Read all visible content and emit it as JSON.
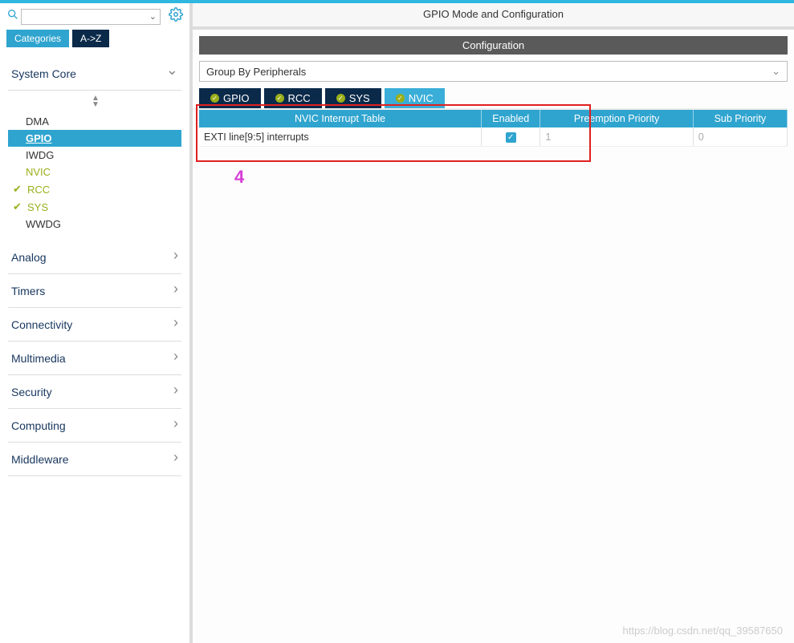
{
  "sidebar": {
    "tabs": {
      "categories": "Categories",
      "az": "A->Z"
    },
    "groups": [
      {
        "name": "System Core",
        "expanded": true,
        "items": [
          {
            "label": "DMA",
            "state": "plain"
          },
          {
            "label": "GPIO",
            "state": "selected"
          },
          {
            "label": "IWDG",
            "state": "plain"
          },
          {
            "label": "NVIC",
            "state": "nvic"
          },
          {
            "label": "RCC",
            "state": "checked"
          },
          {
            "label": "SYS",
            "state": "checked"
          },
          {
            "label": "WWDG",
            "state": "plain"
          }
        ]
      },
      {
        "name": "Analog",
        "expanded": false
      },
      {
        "name": "Timers",
        "expanded": false
      },
      {
        "name": "Connectivity",
        "expanded": false
      },
      {
        "name": "Multimedia",
        "expanded": false
      },
      {
        "name": "Security",
        "expanded": false
      },
      {
        "name": "Computing",
        "expanded": false
      },
      {
        "name": "Middleware",
        "expanded": false
      }
    ]
  },
  "main": {
    "title": "GPIO Mode and Configuration",
    "config_header": "Configuration",
    "group_select": "Group By Peripherals",
    "periph_tabs": [
      {
        "label": "GPIO",
        "active": false
      },
      {
        "label": "RCC",
        "active": false
      },
      {
        "label": "SYS",
        "active": false
      },
      {
        "label": "NVIC",
        "active": true
      }
    ],
    "table": {
      "headers": [
        "NVIC Interrupt Table",
        "Enabled",
        "Preemption Priority",
        "Sub Priority"
      ],
      "rows": [
        {
          "name": "EXTI line[9:5] interrupts",
          "enabled": true,
          "preempt": "1",
          "sub": "0"
        }
      ]
    }
  },
  "annotation": {
    "number": "4"
  },
  "watermark": "https://blog.csdn.net/qq_39587650"
}
